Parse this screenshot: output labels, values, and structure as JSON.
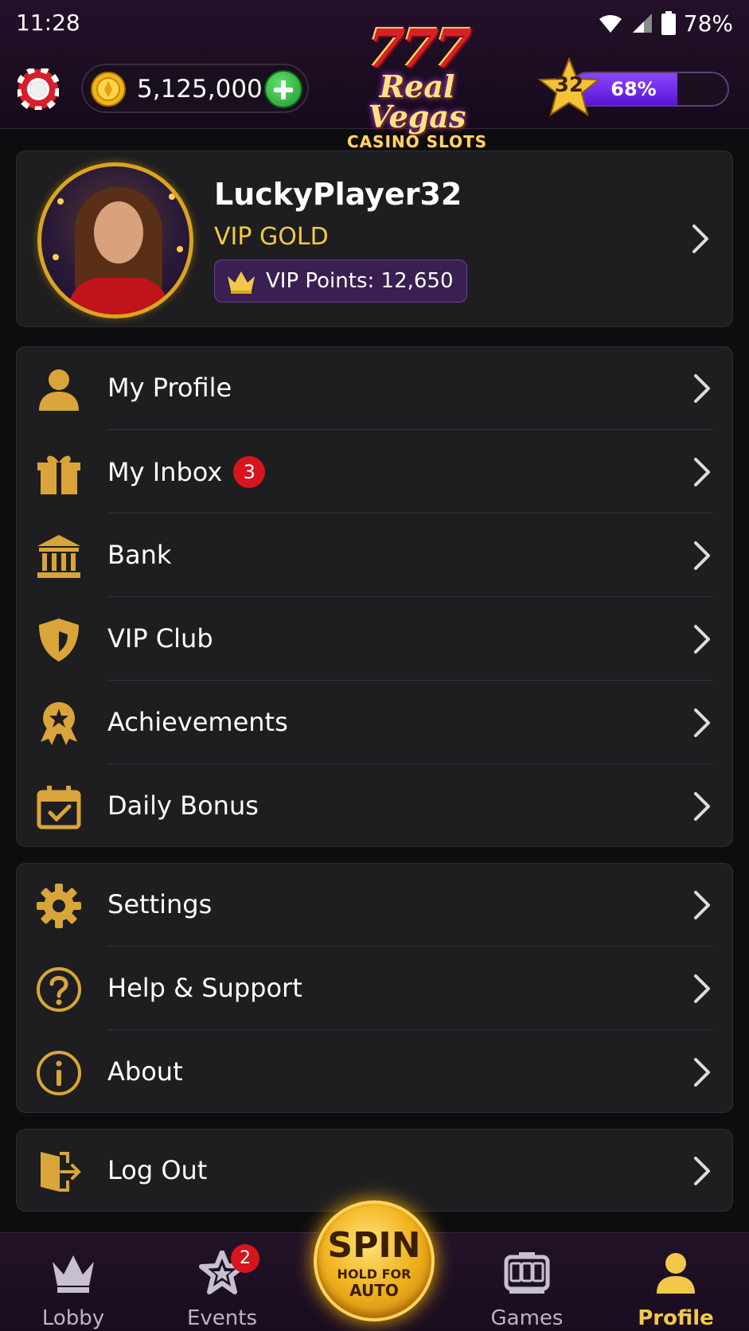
{
  "status_bar": {
    "time": "11:28",
    "battery": "78%"
  },
  "header": {
    "coins": "5,125,000",
    "logo": {
      "sevens": "777",
      "brand": "Real Vegas",
      "subtitle": "CASINO SLOTS"
    },
    "level": {
      "number": "32",
      "progress_label": "68%",
      "progress": 0.68
    }
  },
  "profile": {
    "username": "LuckyPlayer32",
    "vip_tier": "VIP GOLD",
    "vip_points": "VIP Points: 12,650"
  },
  "menu_main": [
    {
      "label": "My Profile",
      "icon": "person-icon"
    },
    {
      "label": "My Inbox",
      "icon": "gift-icon",
      "badge": "3"
    },
    {
      "label": "Bank",
      "icon": "bank-icon"
    },
    {
      "label": "VIP Club",
      "icon": "shield-icon"
    },
    {
      "label": "Achievements",
      "icon": "award-icon"
    },
    {
      "label": "Daily Bonus",
      "icon": "calendar-check-icon"
    }
  ],
  "menu_secondary": [
    {
      "label": "Settings",
      "icon": "gear-icon"
    },
    {
      "label": "Help & Support",
      "icon": "help-icon"
    },
    {
      "label": "About",
      "icon": "info-icon"
    }
  ],
  "menu_logout": {
    "label": "Log Out",
    "icon": "logout-icon"
  },
  "bottom_nav": {
    "lobby": "Lobby",
    "events": "Events",
    "events_badge": "2",
    "spin": "SPIN",
    "spin_hold": "HOLD FOR",
    "spin_auto": "AUTO",
    "games": "Games",
    "profile": "Profile"
  },
  "colors": {
    "accent_gold": "#f2c84b",
    "badge_red": "#d6151f",
    "level_purple": "#7a33f0",
    "background": "#0d0d0f",
    "card": "#1e1e20"
  }
}
